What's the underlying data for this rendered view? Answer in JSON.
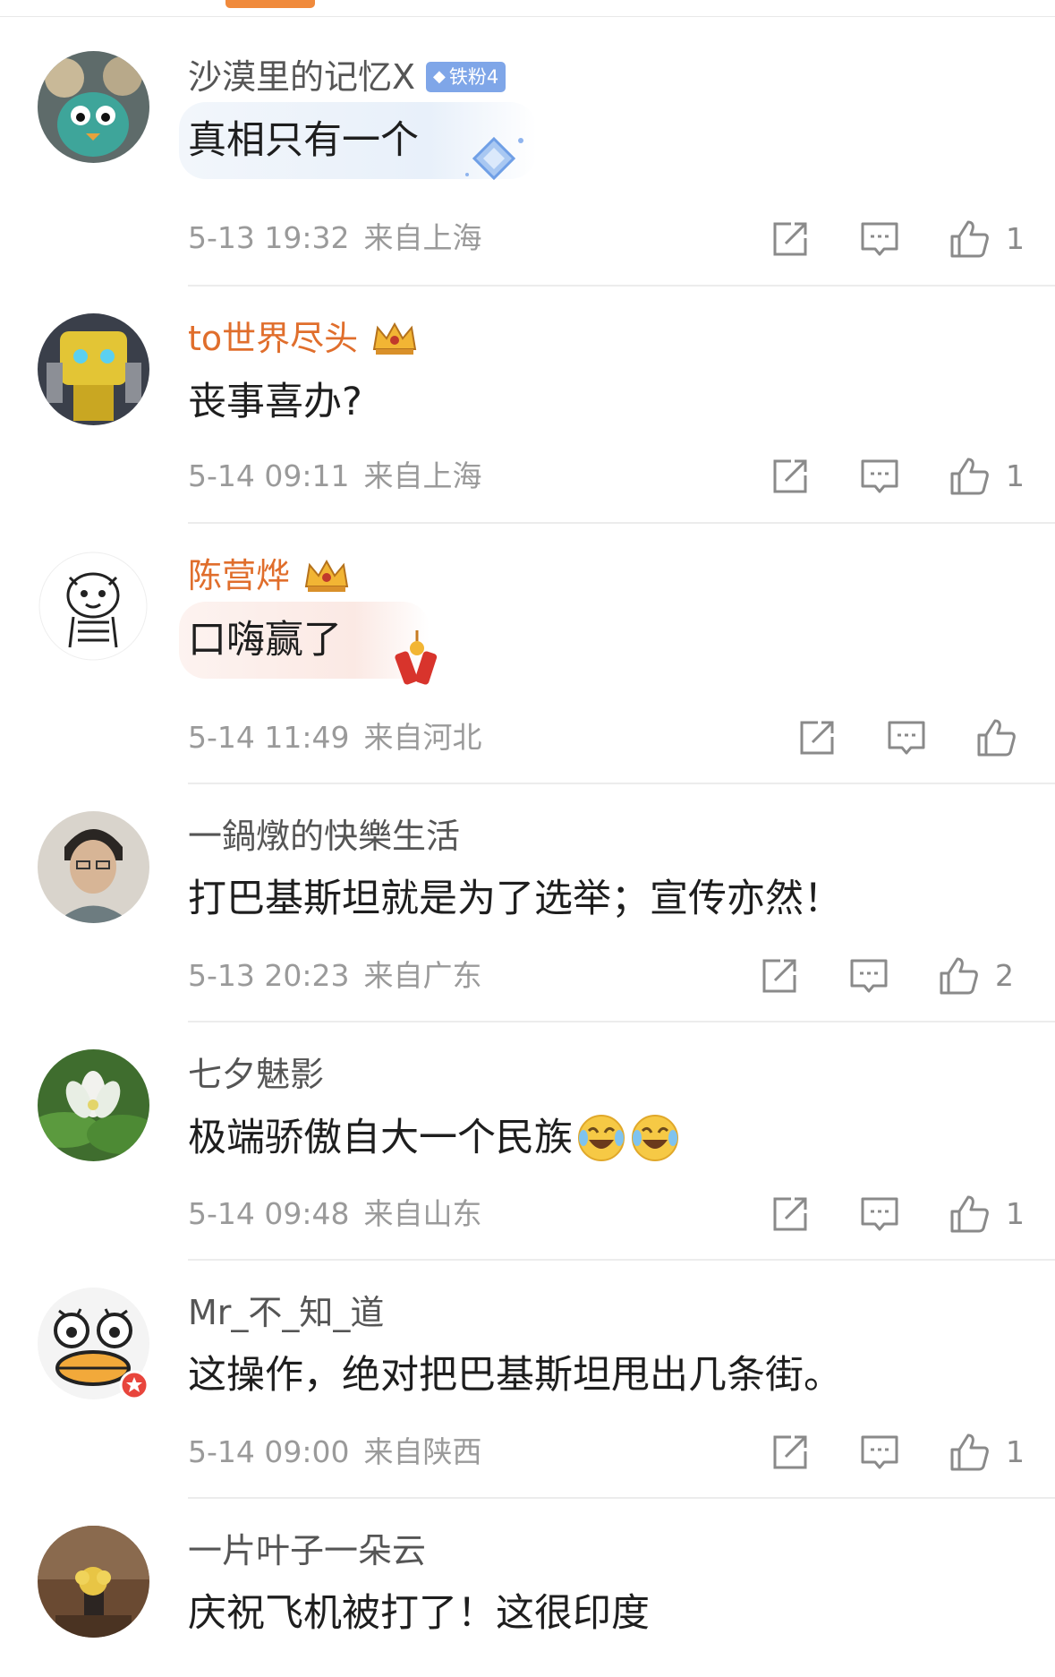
{
  "comments": [
    {
      "username": "沙漠里的记忆X",
      "badge": "铁粉4",
      "text": "真相只有一个",
      "time": "5-13 19:32",
      "location": "来自上海",
      "likes": "1"
    },
    {
      "username": "to世界尽头",
      "text": "丧事喜办?",
      "time": "5-14 09:11",
      "location": "来自上海",
      "likes": "1"
    },
    {
      "username": "陈营烨",
      "text": "口嗨赢了",
      "time": "5-14 11:49",
      "location": "来自河北",
      "likes": ""
    },
    {
      "username": "一鍋燉的快樂生活",
      "text": "打巴基斯坦就是为了选举；宣传亦然！",
      "time": "5-13 20:23",
      "location": "来自广东",
      "likes": "2"
    },
    {
      "username": "七夕魅影",
      "text": "极端骄傲自大一个民族",
      "time": "5-14 09:48",
      "location": "来自山东",
      "likes": "1"
    },
    {
      "username": "Mr_不_知_道",
      "text": "这操作，绝对把巴基斯坦甩出几条街。",
      "time": "5-14 09:00",
      "location": "来自陕西",
      "likes": "1"
    },
    {
      "username": "一片叶子一朵云",
      "text": "庆祝飞机被打了！这很印度",
      "time": "",
      "location": "",
      "likes": ""
    }
  ],
  "colors": {
    "accent": "#f08a3c",
    "vip_name": "#e06e2c",
    "meta": "#9a9a9a",
    "badge": "#7fa6e8"
  },
  "icons": {
    "forward": "forward-icon",
    "reply": "comment-icon",
    "like": "thumbs-up-icon",
    "laugh_cry": "laugh-cry-emoji",
    "crown": "crown-badge-icon"
  }
}
